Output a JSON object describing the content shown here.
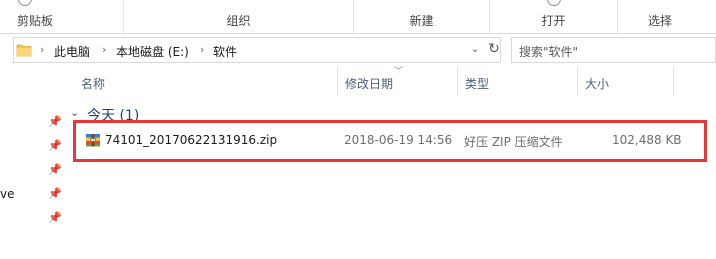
{
  "ribbon": {
    "groups": [
      {
        "label": "剪贴板"
      },
      {
        "label": "组织"
      },
      {
        "label": "新建"
      },
      {
        "label": "打开"
      },
      {
        "label": "选择"
      }
    ]
  },
  "address": {
    "crumbs": [
      "此电脑",
      "本地磁盘 (E:)",
      "软件"
    ],
    "separator": "›"
  },
  "search": {
    "placeholder": "搜索\"软件\""
  },
  "nav": {
    "partial_label": "ve"
  },
  "columns": [
    "名称",
    "修改日期",
    "类型",
    "大小"
  ],
  "group": {
    "label": "今天 (1)"
  },
  "files": [
    {
      "name": "74101_20170622131916.zip",
      "modified": "2018-06-19 14:56",
      "type": "好压 ZIP 压缩文件",
      "size": "102,488 KB",
      "icon": "zip-archive-icon"
    }
  ],
  "colors": {
    "highlight": "#e53935",
    "group_header": "#1e3f86",
    "column_header": "#4c607a"
  }
}
